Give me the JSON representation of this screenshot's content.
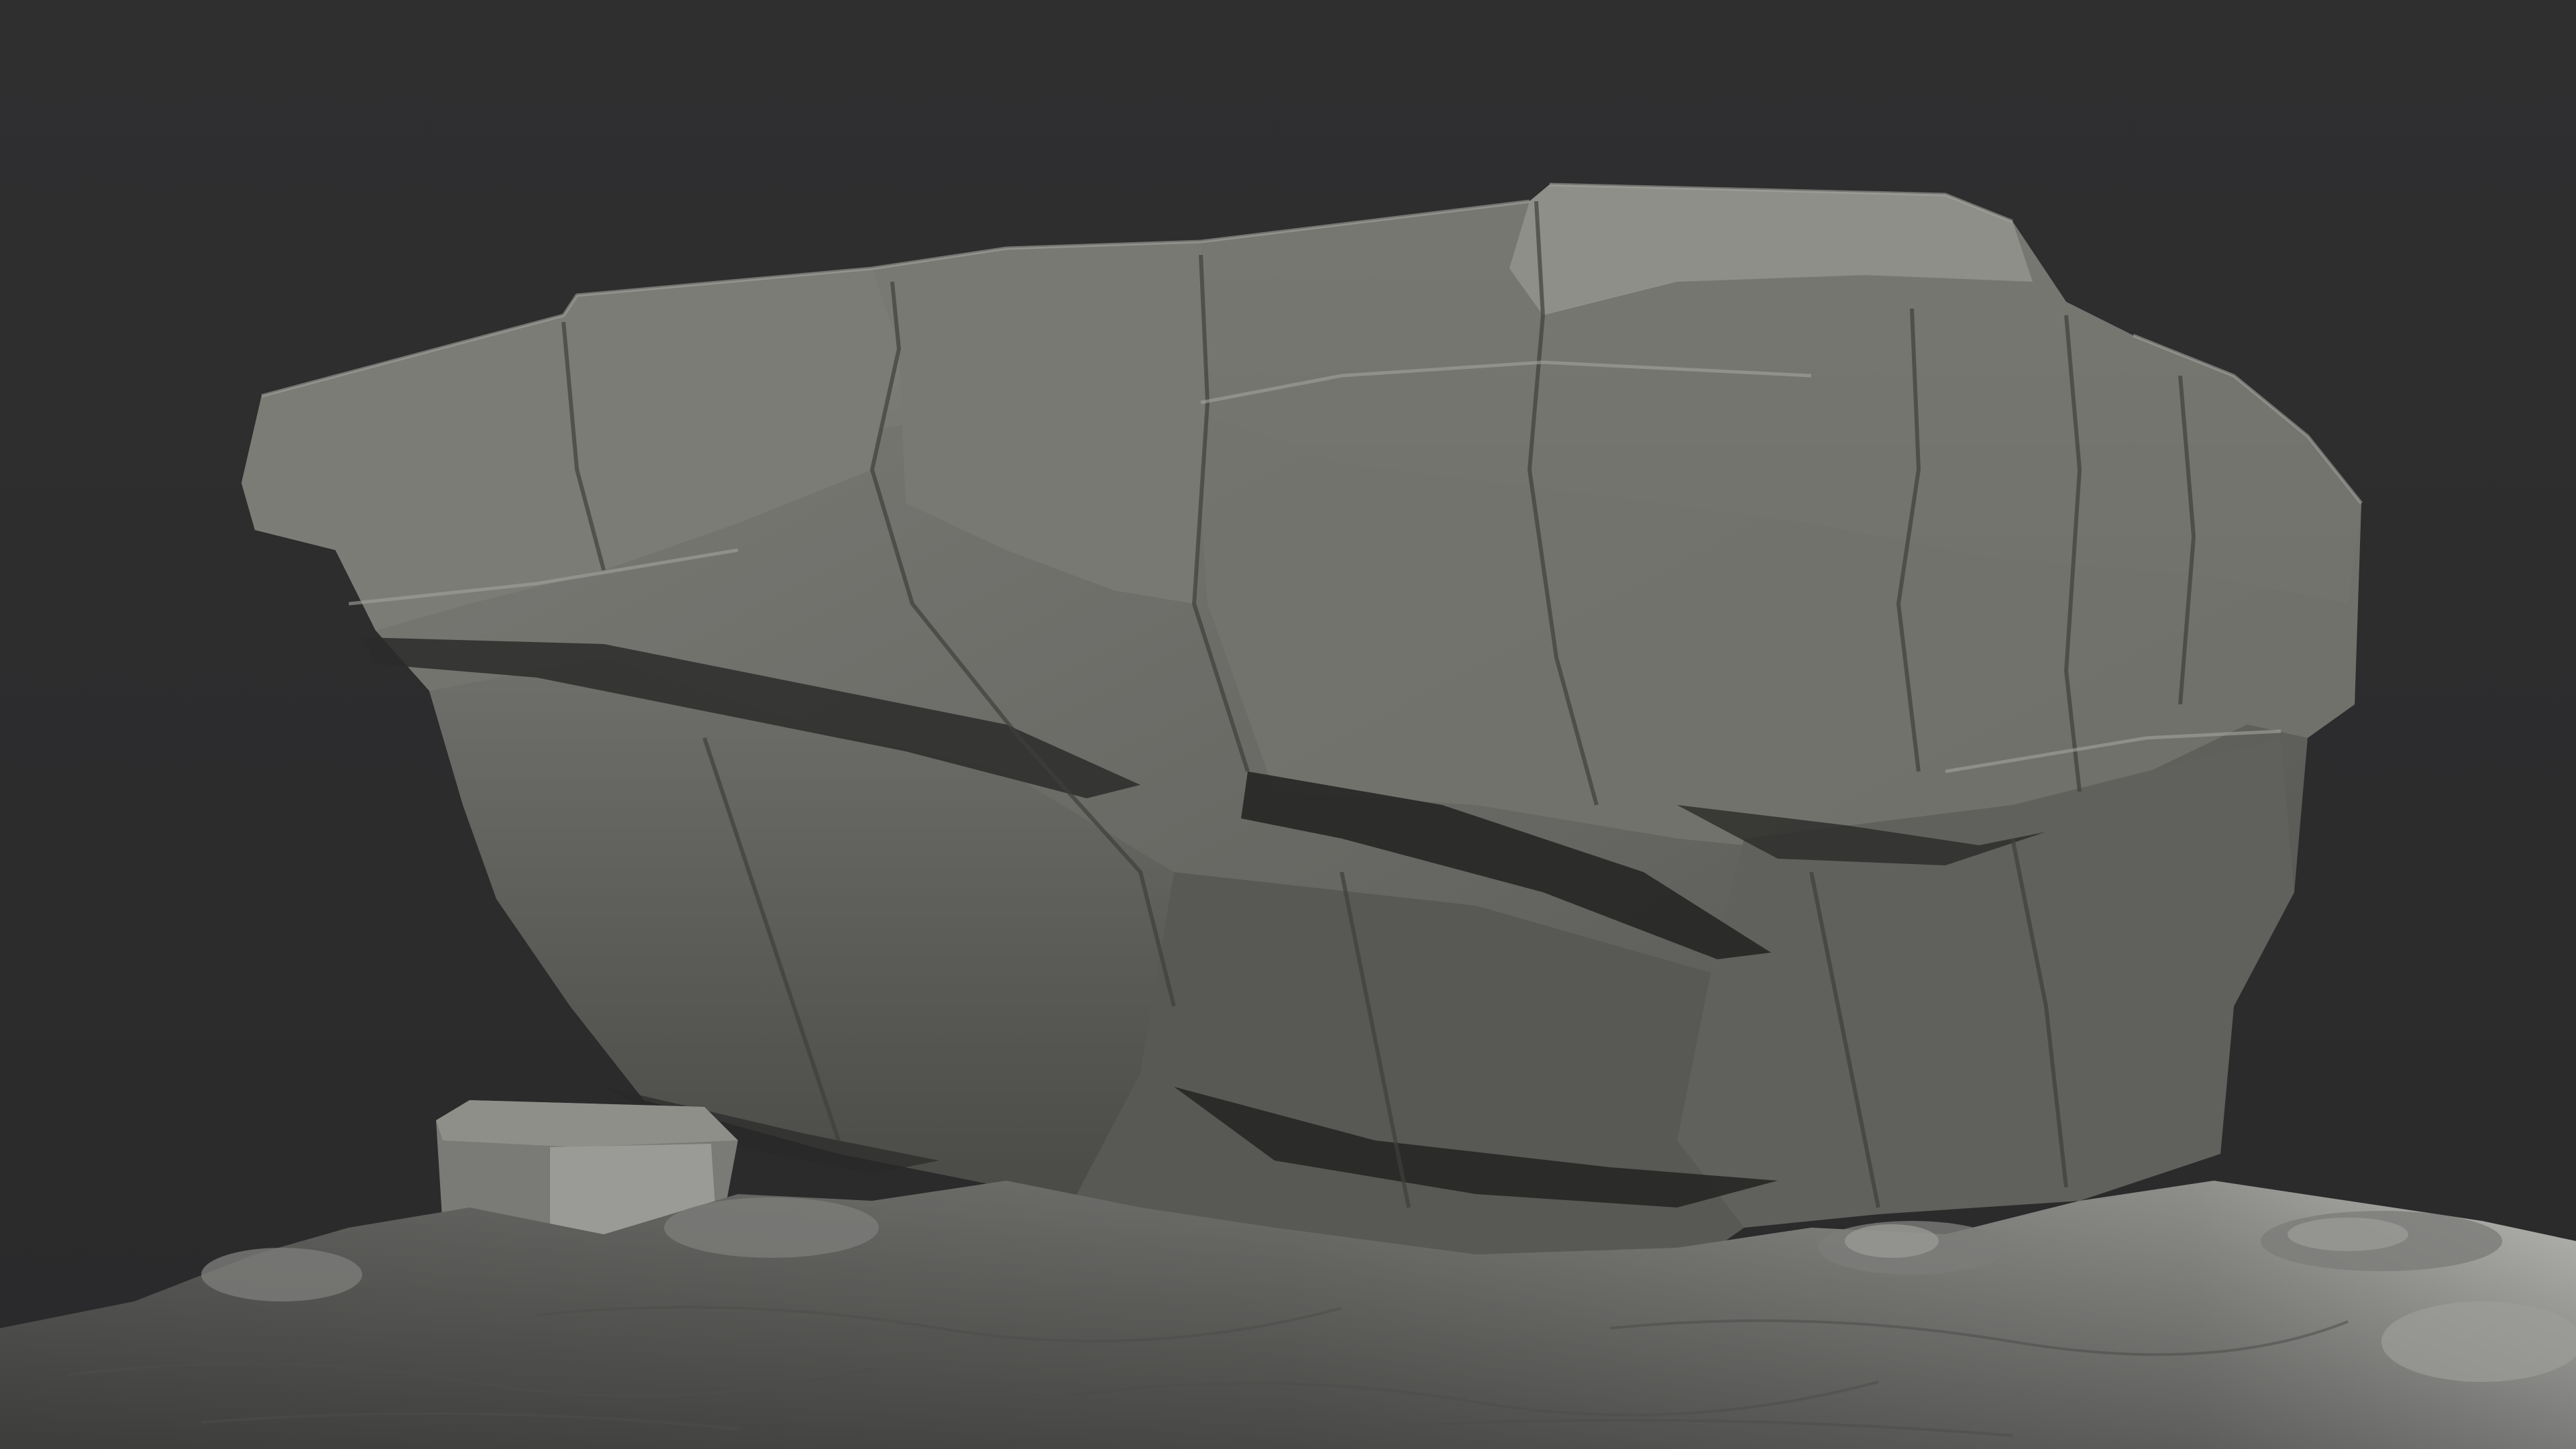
{
  "scene": {
    "subject": "rock-sculpt-render",
    "colors": {
      "background": "#2e2e2f",
      "rock_light": "#8a8a85",
      "rock_mid": "#6b6b67",
      "rock_dark": "#3c3c3a",
      "shadow": "#1f1f1f",
      "ground_light": "#a9a9a6",
      "ground_mid": "#777774",
      "ground_dark": "#4a4a48"
    }
  }
}
